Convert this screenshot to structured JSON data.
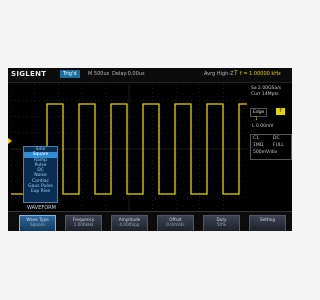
{
  "topbar": {
    "brand": "SIGLENT",
    "trigger_mode": "Trig'd",
    "timebase": "M 500us",
    "delay": "Delay:0.00us",
    "acquisition": "Avrg  High-Z",
    "frequency": "f = 1.00000 kHz",
    "trigger_icon": "T"
  },
  "right_panel": {
    "sample_rate": "Sa 2.00GSa/s",
    "current_memory": "Curr 14Mpts",
    "edge_label": "Edge",
    "edge_icon": "rising-edge-icon",
    "trigger_source": "1",
    "trigger_level": "L 0.00mV",
    "channel": {
      "number": "C1",
      "coupling": "DC",
      "impedance": "1MΩ",
      "bandwidth": "FULL",
      "scale": "500mV/div"
    }
  },
  "wave_menu": {
    "items": [
      {
        "label": "Sine",
        "selected": false
      },
      {
        "label": "Square",
        "selected": true
      },
      {
        "label": "Ramp",
        "selected": false
      },
      {
        "label": "Pulse",
        "selected": false
      },
      {
        "label": "DC",
        "selected": false
      },
      {
        "label": "Noise",
        "selected": false
      },
      {
        "label": "Cardiac",
        "selected": false
      },
      {
        "label": "Gaus Pulse",
        "selected": false
      },
      {
        "label": "Exp Rise",
        "selected": false
      }
    ]
  },
  "channel_tag": "WAVEFORM",
  "softkeys": [
    {
      "label": "Wave Type",
      "value": "Square",
      "active": true
    },
    {
      "label": "Frequency",
      "value": "1.000kHz",
      "active": false
    },
    {
      "label": "Amplitude",
      "value": "4.000Vpp",
      "active": false
    },
    {
      "label": "Offset",
      "value": "0.0mVdc",
      "active": false
    },
    {
      "label": "Duty",
      "value": "50%",
      "active": false
    },
    {
      "label": "Setting",
      "value": "",
      "active": false
    }
  ],
  "waveform": {
    "type": "Square",
    "color": "#e5d400",
    "cycles_visible": 7,
    "duty": 0.5
  },
  "colors": {
    "trace": "#e5d400",
    "grid": "#3a3a3a",
    "accent": "#2d8dd6"
  }
}
